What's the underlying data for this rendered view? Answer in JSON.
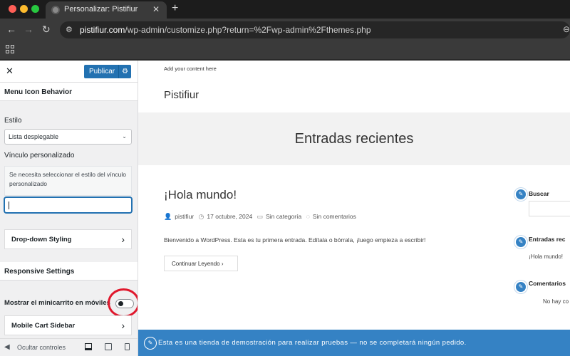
{
  "browser": {
    "tab_title": "Personalizar: Pistifiur",
    "url_domain": "pistifiur.com",
    "url_path": "/wp-admin/customize.php?return=%2Fwp-admin%2Fthemes.php"
  },
  "customizer": {
    "publish_label": "Publicar",
    "section_title": "Menu Icon Behavior",
    "style_label": "Estilo",
    "style_value": "Lista desplegable",
    "custom_link_label": "Vínculo personalizado",
    "custom_link_notice": "Se necesita seleccionar el estilo del vínculo personalizado",
    "custom_link_value": "",
    "dropdown_styling": "Drop-down Styling",
    "responsive_title": "Responsive Settings",
    "mini_cart_label": "Mostrar el minicarrito en móviles",
    "mini_cart_enabled": false,
    "mobile_cart_sidebar": "Mobile Cart Sidebar",
    "hide_controls": "Ocultar controles"
  },
  "preview": {
    "topbar_text": "Add your content here",
    "site_title": "Pistifiur",
    "hero_title": "Entradas recientes",
    "post": {
      "title": "¡Hola mundo!",
      "author": "pistifiur",
      "date": "17 octubre, 2024",
      "category": "Sin categoría",
      "comments": "Sin comentarios",
      "excerpt": "Bienvenido a WordPress. Esta es tu primera entrada. Edítala o bórrala, ¡luego empieza a escribir!",
      "read_more": "Continuar Leyendo"
    },
    "widgets": {
      "search_title": "Buscar",
      "recent_title": "Entradas rec",
      "recent_item": "¡Hola mundo!",
      "comments_title": "Comentarios",
      "comments_item": "No hay co"
    },
    "store_notice": "Esta es una tienda de demostración para realizar pruebas — no se completará ningún pedido."
  },
  "colors": {
    "accent": "#2271b1",
    "notice_bar": "#3582c4",
    "highlight": "#e0182d"
  }
}
